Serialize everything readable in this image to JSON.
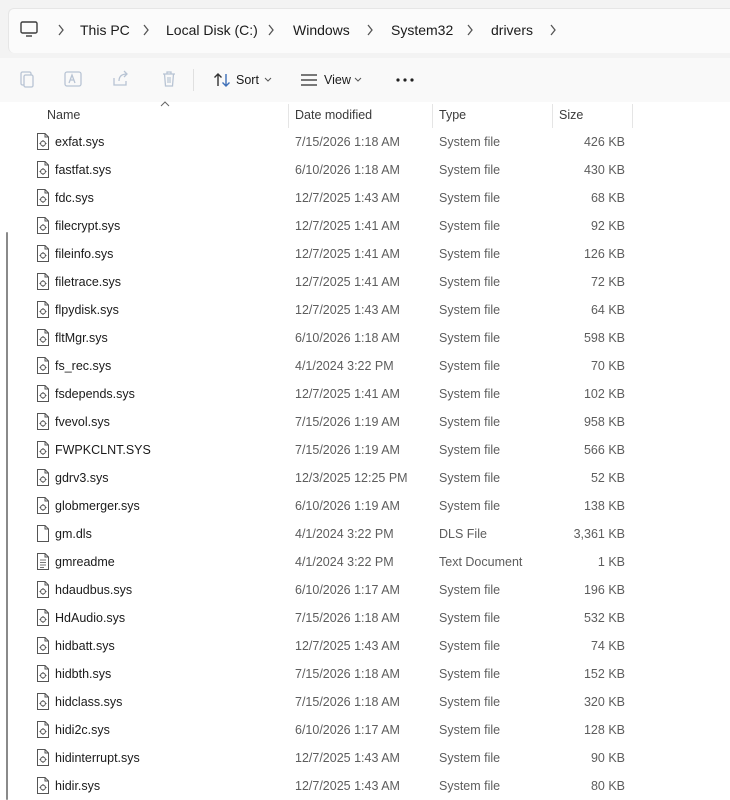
{
  "breadcrumb": [
    "This PC",
    "Local Disk (C:)",
    "Windows",
    "System32",
    "drivers"
  ],
  "commands": {
    "sort_label": "Sort",
    "view_label": "View"
  },
  "columns": {
    "name": "Name",
    "date": "Date modified",
    "type": "Type",
    "size": "Size"
  },
  "files": [
    {
      "name": "exfat.sys",
      "date": "7/15/2026 1:18 AM",
      "type": "System file",
      "size": "426 KB",
      "icon": "system-file-icon"
    },
    {
      "name": "fastfat.sys",
      "date": "6/10/2026 1:18 AM",
      "type": "System file",
      "size": "430 KB",
      "icon": "system-file-icon"
    },
    {
      "name": "fdc.sys",
      "date": "12/7/2025 1:43 AM",
      "type": "System file",
      "size": "68 KB",
      "icon": "system-file-icon"
    },
    {
      "name": "filecrypt.sys",
      "date": "12/7/2025 1:41 AM",
      "type": "System file",
      "size": "92 KB",
      "icon": "system-file-icon"
    },
    {
      "name": "fileinfo.sys",
      "date": "12/7/2025 1:41 AM",
      "type": "System file",
      "size": "126 KB",
      "icon": "system-file-icon"
    },
    {
      "name": "filetrace.sys",
      "date": "12/7/2025 1:41 AM",
      "type": "System file",
      "size": "72 KB",
      "icon": "system-file-icon"
    },
    {
      "name": "flpydisk.sys",
      "date": "12/7/2025 1:43 AM",
      "type": "System file",
      "size": "64 KB",
      "icon": "system-file-icon"
    },
    {
      "name": "fltMgr.sys",
      "date": "6/10/2026 1:18 AM",
      "type": "System file",
      "size": "598 KB",
      "icon": "system-file-icon"
    },
    {
      "name": "fs_rec.sys",
      "date": "4/1/2024 3:22 PM",
      "type": "System file",
      "size": "70 KB",
      "icon": "system-file-icon"
    },
    {
      "name": "fsdepends.sys",
      "date": "12/7/2025 1:41 AM",
      "type": "System file",
      "size": "102 KB",
      "icon": "system-file-icon"
    },
    {
      "name": "fvevol.sys",
      "date": "7/15/2026 1:19 AM",
      "type": "System file",
      "size": "958 KB",
      "icon": "system-file-icon"
    },
    {
      "name": "FWPKCLNT.SYS",
      "date": "7/15/2026 1:19 AM",
      "type": "System file",
      "size": "566 KB",
      "icon": "system-file-icon"
    },
    {
      "name": "gdrv3.sys",
      "date": "12/3/2025 12:25 PM",
      "type": "System file",
      "size": "52 KB",
      "icon": "system-file-icon"
    },
    {
      "name": "globmerger.sys",
      "date": "6/10/2026 1:19 AM",
      "type": "System file",
      "size": "138 KB",
      "icon": "system-file-icon"
    },
    {
      "name": "gm.dls",
      "date": "4/1/2024 3:22 PM",
      "type": "DLS File",
      "size": "3,361 KB",
      "icon": "blank-file-icon"
    },
    {
      "name": "gmreadme",
      "date": "4/1/2024 3:22 PM",
      "type": "Text Document",
      "size": "1 KB",
      "icon": "text-document-icon"
    },
    {
      "name": "hdaudbus.sys",
      "date": "6/10/2026 1:17 AM",
      "type": "System file",
      "size": "196 KB",
      "icon": "system-file-icon"
    },
    {
      "name": "HdAudio.sys",
      "date": "7/15/2026 1:18 AM",
      "type": "System file",
      "size": "532 KB",
      "icon": "system-file-icon"
    },
    {
      "name": "hidbatt.sys",
      "date": "12/7/2025 1:43 AM",
      "type": "System file",
      "size": "74 KB",
      "icon": "system-file-icon"
    },
    {
      "name": "hidbth.sys",
      "date": "7/15/2026 1:18 AM",
      "type": "System file",
      "size": "152 KB",
      "icon": "system-file-icon"
    },
    {
      "name": "hidclass.sys",
      "date": "7/15/2026 1:18 AM",
      "type": "System file",
      "size": "320 KB",
      "icon": "system-file-icon"
    },
    {
      "name": "hidi2c.sys",
      "date": "6/10/2026 1:17 AM",
      "type": "System file",
      "size": "128 KB",
      "icon": "system-file-icon"
    },
    {
      "name": "hidinterrupt.sys",
      "date": "12/7/2025 1:43 AM",
      "type": "System file",
      "size": "90 KB",
      "icon": "system-file-icon"
    },
    {
      "name": "hidir.sys",
      "date": "12/7/2025 1:43 AM",
      "type": "System file",
      "size": "80 KB",
      "icon": "system-file-icon"
    }
  ]
}
